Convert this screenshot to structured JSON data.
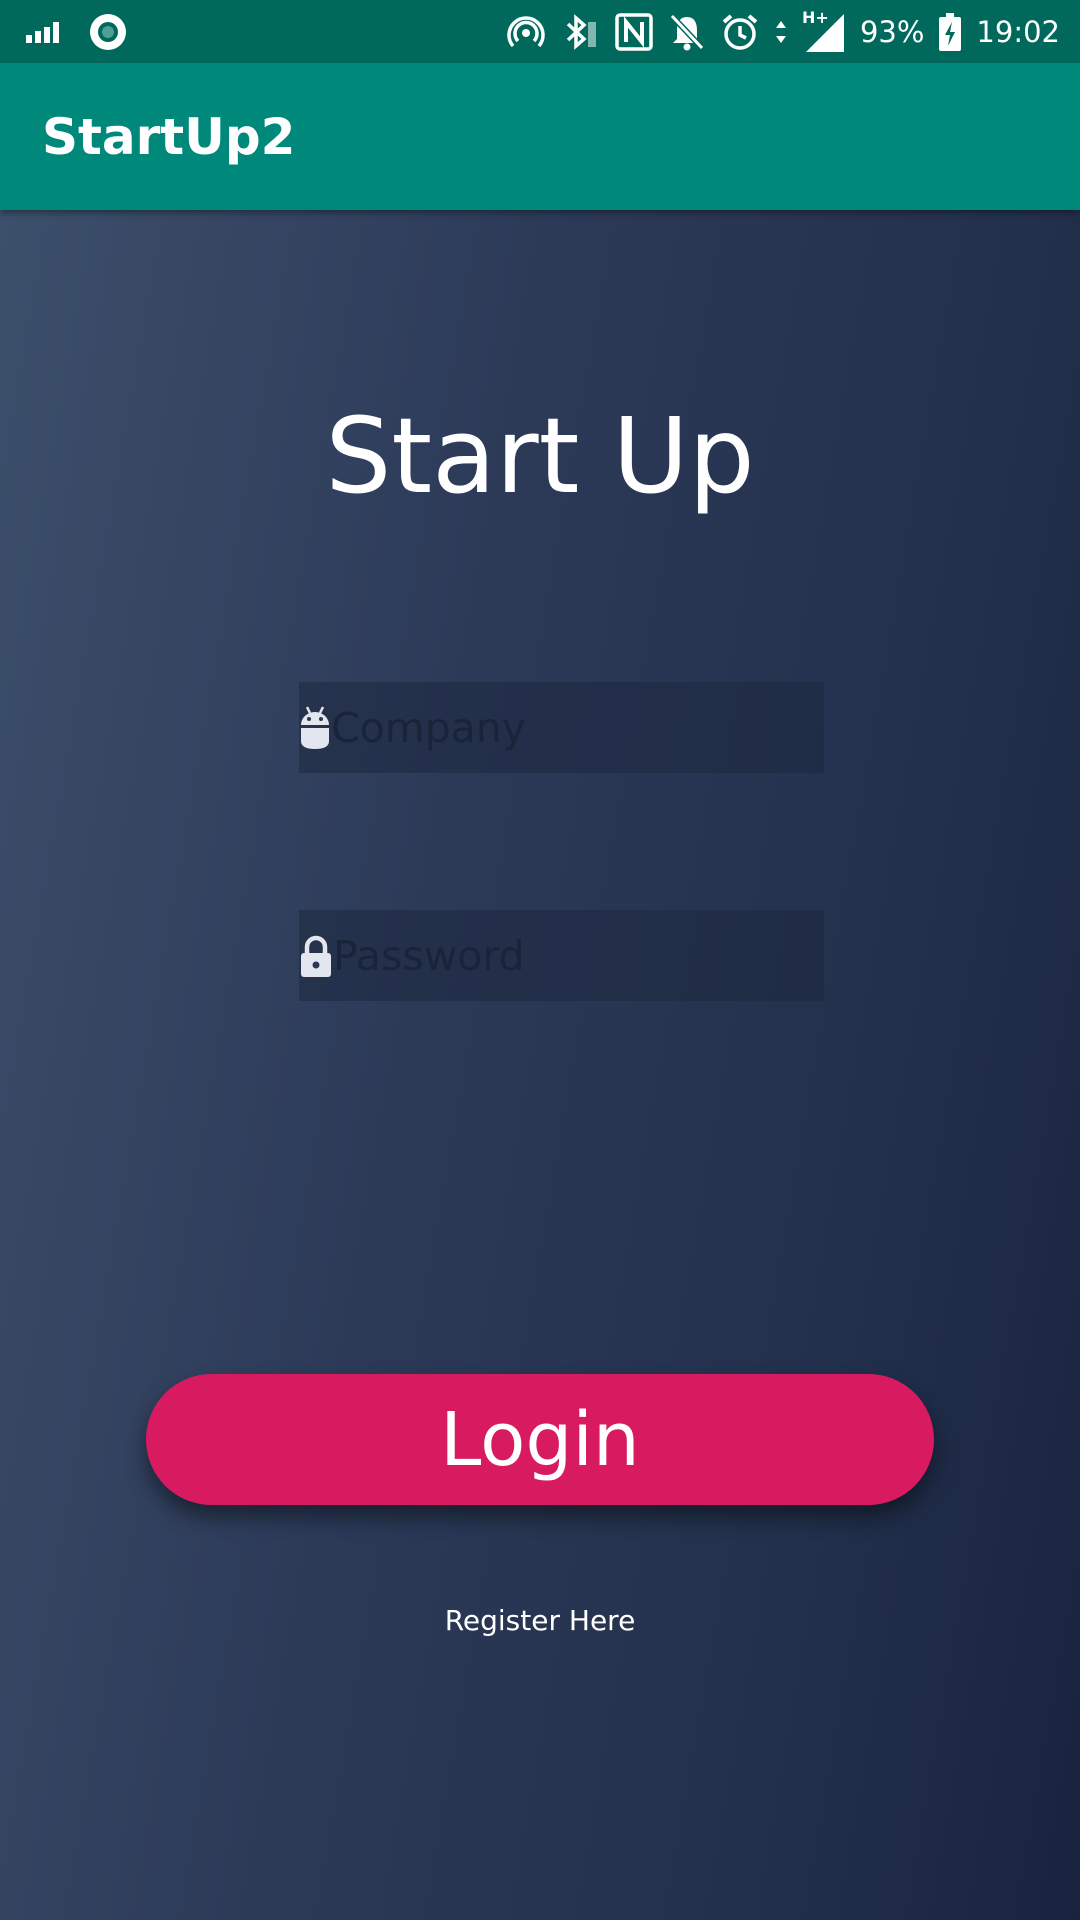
{
  "status_bar": {
    "battery": "93%",
    "time": "19:02",
    "network_type": "H+",
    "icons": [
      "signal-icon",
      "record-icon",
      "hotspot-icon",
      "bluetooth-icon",
      "nfc-icon",
      "notifications-off-icon",
      "alarm-icon",
      "data-arrows-icon",
      "cell-signal-icon",
      "battery-charging-icon"
    ]
  },
  "app_bar": {
    "title": "StartUp2"
  },
  "main": {
    "title": "Start Up",
    "company_field": {
      "placeholder": "Company",
      "value": "",
      "icon": "android-icon"
    },
    "password_field": {
      "placeholder": "Password",
      "value": "",
      "icon": "lock-icon"
    },
    "login_label": "Login",
    "register_label": "Register Here"
  },
  "colors": {
    "status_bar": "#00695c",
    "app_bar": "#00897b",
    "accent": "#d81b60",
    "background_dark": "#19233f",
    "background_light": "#3c4f6b"
  }
}
